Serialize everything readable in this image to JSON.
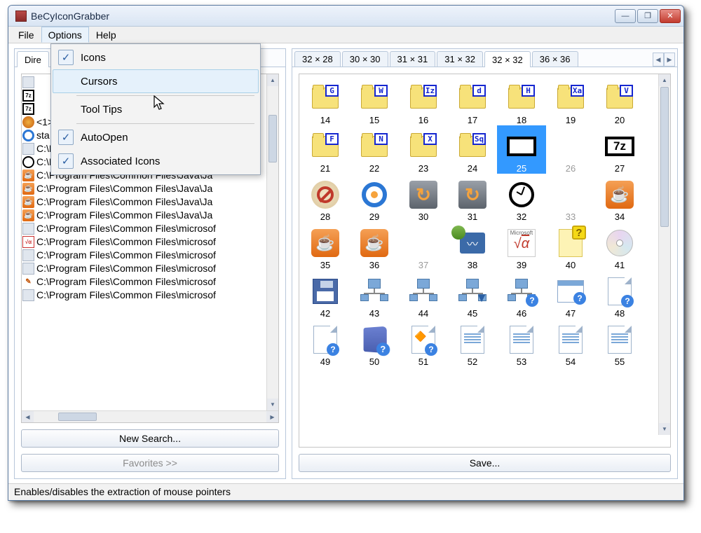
{
  "title": "BeCyIconGrabber",
  "menubar": [
    "File",
    "Options",
    "Help"
  ],
  "options_menu": {
    "icons": "Icons",
    "cursors": "Cursors",
    "tooltips": "Tool Tips",
    "autoopen": "AutoOpen",
    "assoc": "Associated Icons"
  },
  "left_tab_truncated": "Dire",
  "size_tabs": [
    "32 × 28",
    "30 × 30",
    "31 × 31",
    "31 × 32",
    "32 × 32",
    "36 × 36"
  ],
  "active_size_tab_index": 4,
  "file_rows": [
    {
      "icon": "dll",
      "text": ""
    },
    {
      "icon": "7z",
      "text": ""
    },
    {
      "icon": "7z",
      "text": ""
    },
    {
      "icon": "globe",
      "text": "<1>"
    },
    {
      "icon": "ring",
      "text": "sta"
    },
    {
      "icon": "tiny",
      "text": "C:\\Program Files\\Common Files\\InstallSh"
    },
    {
      "icon": "clock",
      "text": "C:\\Program Files\\Common Files\\InstallSh"
    },
    {
      "icon": "java",
      "text": "C:\\Program Files\\Common Files\\Java\\Ja"
    },
    {
      "icon": "java",
      "text": "C:\\Program Files\\Common Files\\Java\\Ja"
    },
    {
      "icon": "java",
      "text": "C:\\Program Files\\Common Files\\Java\\Ja"
    },
    {
      "icon": "java",
      "text": "C:\\Program Files\\Common Files\\Java\\Ja"
    },
    {
      "icon": "dll",
      "text": "C:\\Program Files\\Common Files\\microsof"
    },
    {
      "icon": "sqrt",
      "text": "C:\\Program Files\\Common Files\\microsof"
    },
    {
      "icon": "dll",
      "text": "C:\\Program Files\\Common Files\\microsof"
    },
    {
      "icon": "dll",
      "text": "C:\\Program Files\\Common Files\\microsof"
    },
    {
      "icon": "tools",
      "text": "C:\\Program Files\\Common Files\\microsof"
    },
    {
      "icon": "dll",
      "text": "C:\\Program Files\\Common Files\\microsof"
    }
  ],
  "buttons": {
    "new_search": "New Search...",
    "favorites": "Favorites >>",
    "save": "Save..."
  },
  "icon_grid": [
    [
      {
        "n": 14,
        "t": "folder",
        "o": "G"
      },
      {
        "n": 15,
        "t": "folder",
        "o": "W"
      },
      {
        "n": 16,
        "t": "folder",
        "o": "Iz"
      },
      {
        "n": 17,
        "t": "folder",
        "o": "d"
      },
      {
        "n": 18,
        "t": "folder",
        "o": "H"
      },
      {
        "n": 19,
        "t": "folder",
        "o": "Xa"
      },
      {
        "n": 20,
        "t": "folder",
        "o": "V"
      }
    ],
    [
      {
        "n": 21,
        "t": "folder",
        "o": "F"
      },
      {
        "n": 22,
        "t": "folder",
        "o": "N"
      },
      {
        "n": 23,
        "t": "folder",
        "o": "X"
      },
      {
        "n": 24,
        "t": "folder",
        "o": "Sq"
      },
      {
        "n": 25,
        "t": "7z",
        "sel": true
      },
      {
        "n": 26,
        "t": "blank",
        "dim": true
      },
      {
        "n": 27,
        "t": "7z"
      }
    ],
    [
      {
        "n": 28,
        "t": "forbid"
      },
      {
        "n": 29,
        "t": "ring"
      },
      {
        "n": 30,
        "t": "svn"
      },
      {
        "n": 31,
        "t": "svn"
      },
      {
        "n": 32,
        "t": "clock"
      },
      {
        "n": 33,
        "t": "blank",
        "dim": true
      },
      {
        "n": 34,
        "t": "java"
      }
    ],
    [
      {
        "n": 35,
        "t": "java"
      },
      {
        "n": 36,
        "t": "java"
      },
      {
        "n": 37,
        "t": "blank",
        "dim": true
      },
      {
        "n": 38,
        "t": "chart"
      },
      {
        "n": 39,
        "t": "sqrt"
      },
      {
        "n": 40,
        "t": "help"
      },
      {
        "n": 41,
        "t": "disc"
      }
    ],
    [
      {
        "n": 42,
        "t": "floppy"
      },
      {
        "n": 43,
        "t": "net"
      },
      {
        "n": 44,
        "t": "net"
      },
      {
        "n": 45,
        "t": "netf"
      },
      {
        "n": 46,
        "t": "netq"
      },
      {
        "n": 47,
        "t": "winq"
      },
      {
        "n": 48,
        "t": "docq"
      }
    ],
    [
      {
        "n": 49,
        "t": "docq"
      },
      {
        "n": 50,
        "t": "bookq"
      },
      {
        "n": 51,
        "t": "flagq"
      },
      {
        "n": 52,
        "t": "list"
      },
      {
        "n": 53,
        "t": "list"
      },
      {
        "n": 54,
        "t": "list"
      },
      {
        "n": 55,
        "t": "list"
      }
    ]
  ],
  "statusbar": "Enables/disables the extraction of mouse pointers"
}
